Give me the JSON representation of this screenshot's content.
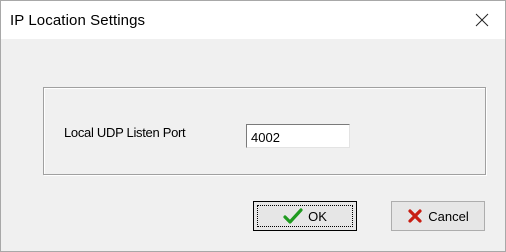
{
  "window": {
    "title": "IP Location Settings"
  },
  "form": {
    "port_label": "Local UDP Listen Port",
    "port_value": "4002"
  },
  "buttons": {
    "ok_label": "OK",
    "cancel_label": "Cancel"
  },
  "icons": {
    "ok": "checkmark-icon",
    "cancel": "x-mark-icon",
    "close": "close-icon"
  },
  "colors": {
    "ok_icon": "#1f9a1f",
    "cancel_icon": "#c81e12"
  }
}
